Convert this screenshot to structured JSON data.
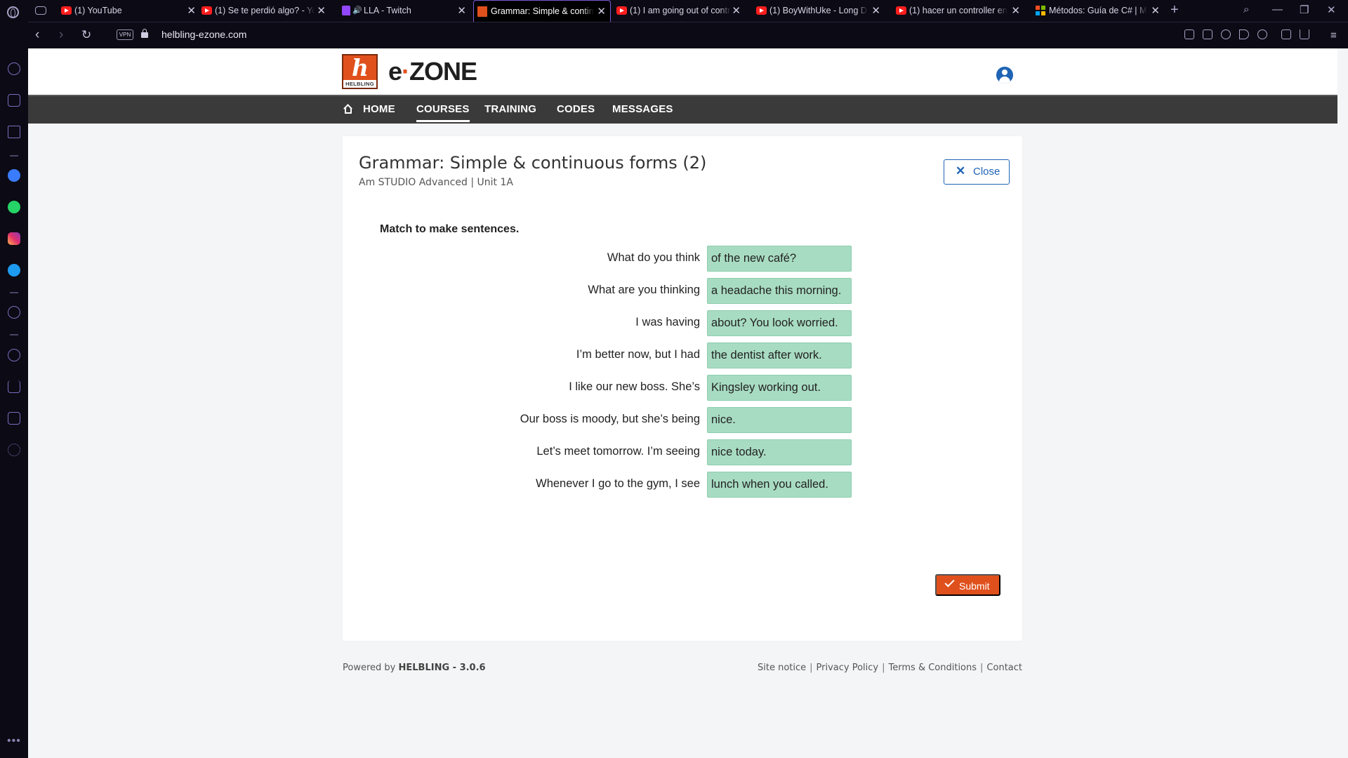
{
  "browser": {
    "tabs": [
      {
        "title": "(1) YouTube",
        "icon": "youtube-icon",
        "active": false
      },
      {
        "title": "(1) Se te perdió algo? - You",
        "icon": "youtube-icon",
        "active": false
      },
      {
        "title": "LLA - Twitch",
        "icon": "twitch-icon",
        "active": false
      },
      {
        "title": "Grammar: Simple & contin",
        "icon": "helbling-icon",
        "active": true
      },
      {
        "title": "(1) I am going out of contr",
        "icon": "youtube-icon",
        "active": false
      },
      {
        "title": "(1) BoyWithUke - Long Dri",
        "icon": "youtube-icon",
        "active": false
      },
      {
        "title": "(1) hacer un controller en A",
        "icon": "youtube-icon",
        "active": false
      },
      {
        "title": "Métodos: Guía de C# | Mic",
        "icon": "microsoft-icon",
        "active": false
      }
    ],
    "vpn_label": "VPN",
    "url": "helbling-ezone.com",
    "accent": "#7a5ad8"
  },
  "site": {
    "logo_letter": "h",
    "logo_caption": "HELBLING",
    "brand_prefix": "e",
    "brand_dot": "·",
    "brand_suffix": "ZONE",
    "brand_color": "#e0501c",
    "nav": {
      "home": "HOME",
      "courses": "COURSES",
      "training": "TRAINING",
      "codes": "CODES",
      "messages": "MESSAGES",
      "active": "COURSES"
    }
  },
  "exercise": {
    "title": "Grammar: Simple & continuous forms (2)",
    "subtitle": "Am STUDIO Advanced | Unit 1A",
    "close_label": "Close",
    "instruction": "Match to make sentences.",
    "rows": [
      {
        "prompt": "What do you think",
        "answer": "of the new café?"
      },
      {
        "prompt": "What are you thinking",
        "answer": "a headache this morning."
      },
      {
        "prompt": "I was having",
        "answer": "about? You look worried."
      },
      {
        "prompt": "I’m better now, but I had",
        "answer": "the dentist after work."
      },
      {
        "prompt": "I like our new boss. She’s",
        "answer": "Kingsley working out."
      },
      {
        "prompt": "Our boss is moody, but she’s being",
        "answer": "nice."
      },
      {
        "prompt": "Let’s meet tomorrow. I’m seeing",
        "answer": "nice today."
      },
      {
        "prompt": "Whenever I go to the gym, I see",
        "answer": "lunch when you called."
      }
    ],
    "submit_label": "Submit",
    "answer_color": "#a8dcc2",
    "submit_color": "#e0501c"
  },
  "footer": {
    "powered_prefix": "Powered by",
    "powered_brand": "HELBLING - 3.0.6",
    "links": [
      "Site notice",
      "Privacy Policy",
      "Terms & Conditions",
      "Contact"
    ],
    "separator": "|"
  }
}
